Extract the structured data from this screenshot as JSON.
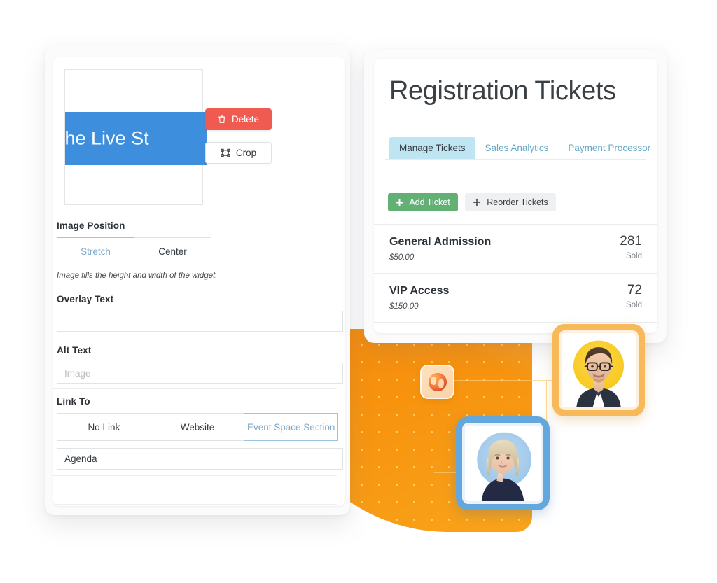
{
  "left_panel": {
    "image_preview": {
      "overlay_text": "the Live St",
      "band_color": "#3e8ede"
    },
    "buttons": [
      {
        "id": "delete",
        "label": "Delete",
        "icon": "trash-icon",
        "color": "#ef5b51"
      },
      {
        "id": "crop",
        "label": "Crop",
        "icon": "crop-icon",
        "color": "#ffffff"
      }
    ],
    "image_position": {
      "label": "Image Position",
      "options": [
        "Stretch",
        "Center"
      ],
      "selected": "Stretch",
      "help": "Image fills the height and width of the widget."
    },
    "overlay_text": {
      "label": "Overlay Text",
      "value": "",
      "placeholder": ""
    },
    "alt_text": {
      "label": "Alt Text",
      "value": "",
      "placeholder": "Image"
    },
    "link_to": {
      "label": "Link To",
      "options": [
        "No Link",
        "Website",
        "Event Space Section"
      ],
      "selected": "Event Space Section",
      "section_value": "Agenda"
    }
  },
  "right_panel": {
    "title": "Registration Tickets",
    "tabs": [
      {
        "label": "Manage Tickets",
        "active": true
      },
      {
        "label": "Sales Analytics",
        "active": false
      },
      {
        "label": "Payment Processor",
        "active": false
      }
    ],
    "actions": [
      {
        "id": "add-ticket",
        "label": "Add Ticket",
        "icon": "plus-icon",
        "color": "#62b074"
      },
      {
        "id": "reorder-tickets",
        "label": "Reorder Tickets",
        "icon": "move-icon",
        "color": "#eef0f1"
      }
    ],
    "tickets": [
      {
        "name": "General Admission",
        "price": "$50.00",
        "count": "281",
        "count_label": "Sold"
      },
      {
        "name": "VIP Access",
        "price": "$150.00",
        "count": "72",
        "count_label": "Sold"
      }
    ]
  },
  "decor": {
    "globe_badge_icon": "globe-icon",
    "avatar_man_alt": "man-avatar",
    "avatar_woman_alt": "woman-avatar",
    "blob_color": "#f7930f",
    "avatar_man_frame_color": "#f7b95a",
    "avatar_woman_frame_color": "#63a7dd"
  }
}
